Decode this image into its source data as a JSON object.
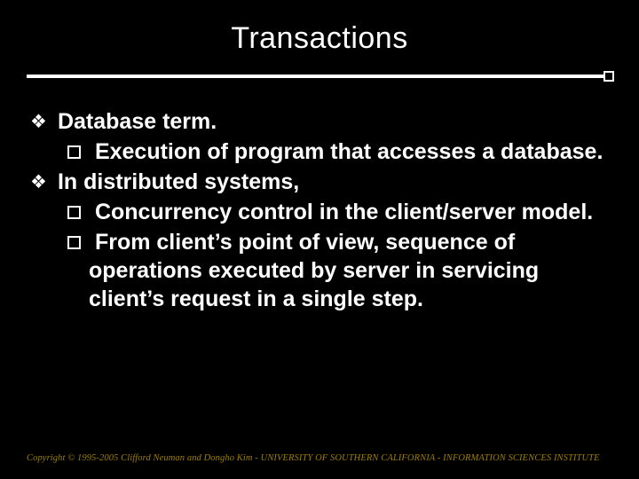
{
  "title": "Transactions",
  "bullets": {
    "b1": "Database term.",
    "b1a": "Execution of program that accesses a database.",
    "b2": "In distributed systems,",
    "b2a": "Concurrency control in the client/server model.",
    "b2b": "From client’s point of view, sequence of operations executed by server in servicing client’s request in a single step."
  },
  "footer": "Copyright © 1995-2005 Clifford Neuman and Dongho Kim - UNIVERSITY OF SOUTHERN CALIFORNIA - INFORMATION SCIENCES INSTITUTE"
}
